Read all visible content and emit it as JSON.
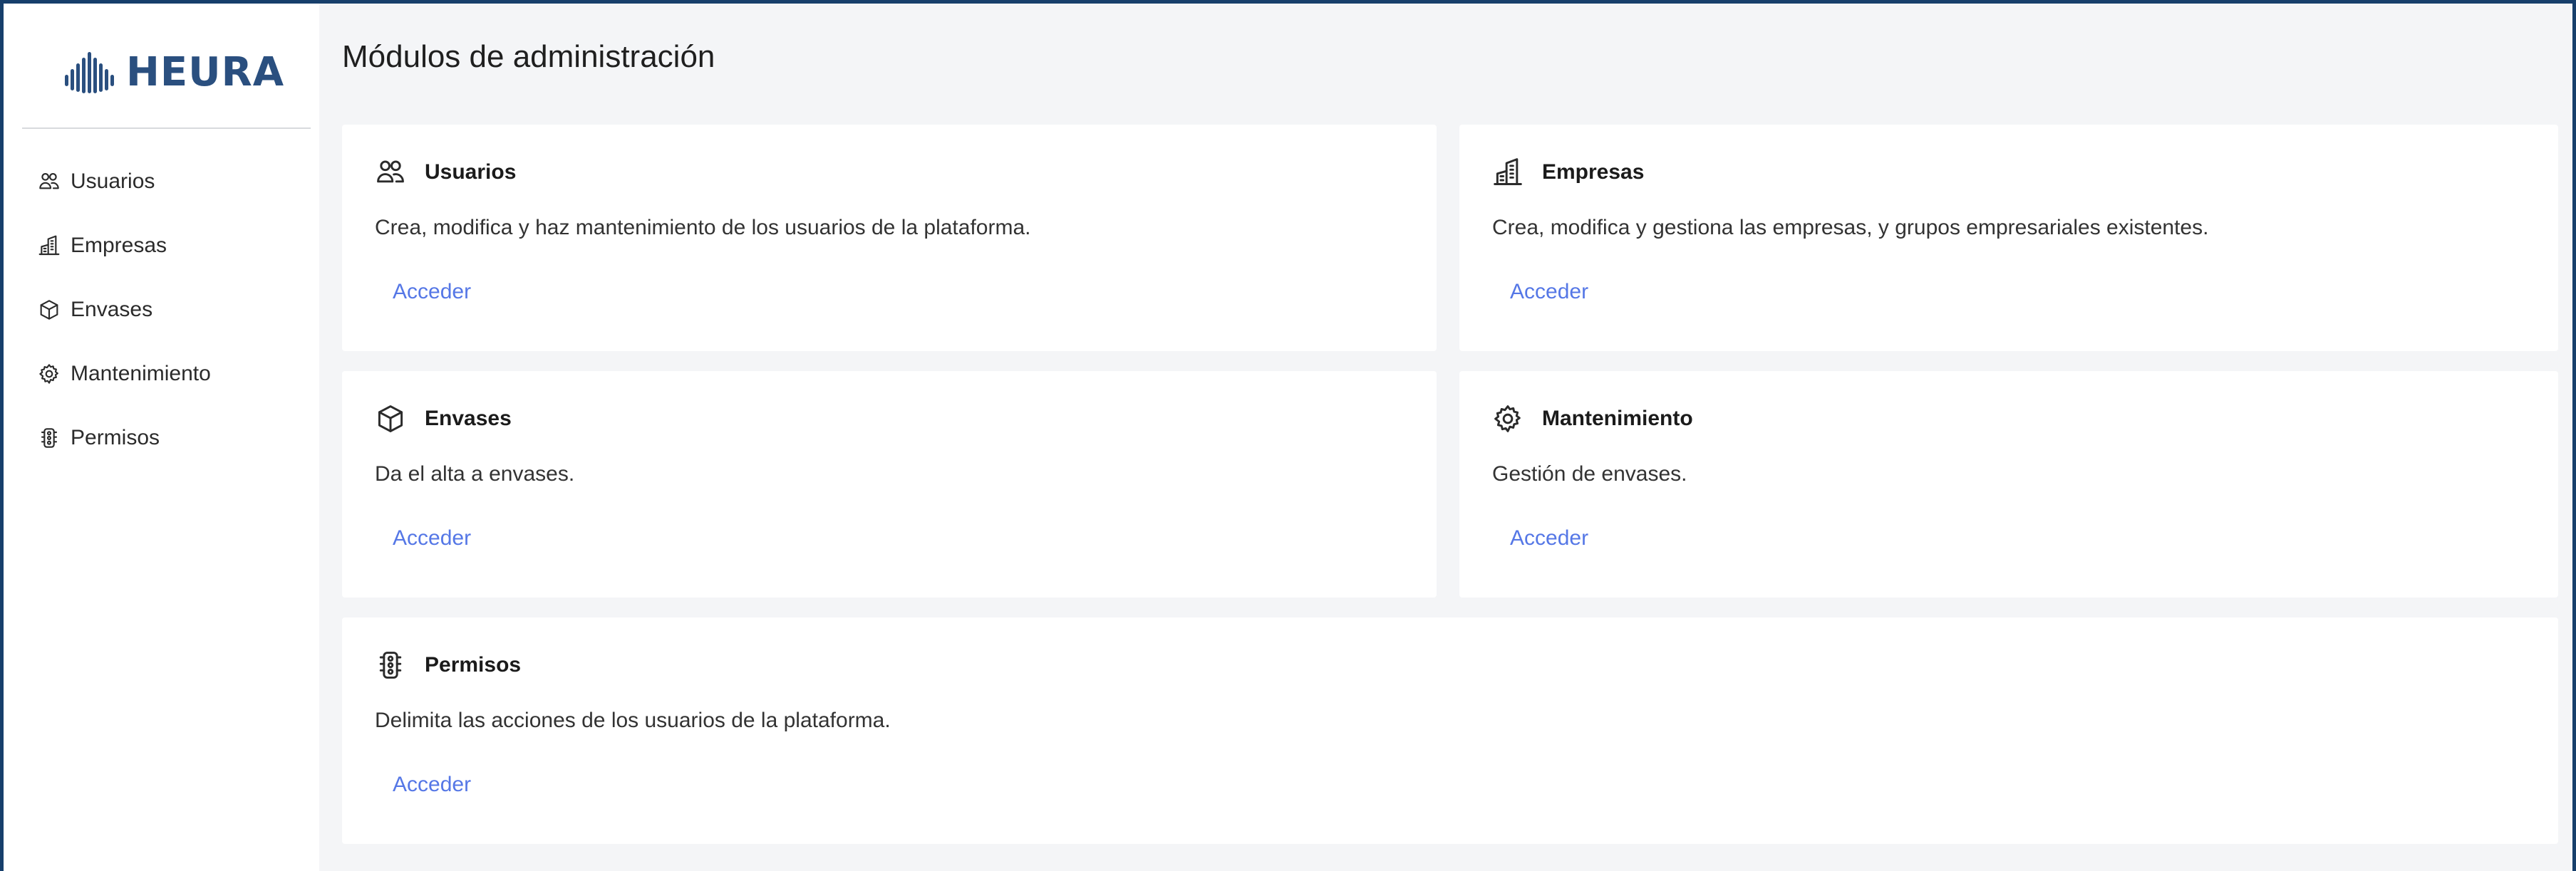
{
  "app": {
    "brand_name": "HEURA",
    "brand_color": "#2a4f7f",
    "accent_color": "#5577e6"
  },
  "sidebar": {
    "items": [
      {
        "label": "Usuarios",
        "icon": "users-icon"
      },
      {
        "label": "Empresas",
        "icon": "building-icon"
      },
      {
        "label": "Envases",
        "icon": "box-icon"
      },
      {
        "label": "Mantenimiento",
        "icon": "gear-icon"
      },
      {
        "label": "Permisos",
        "icon": "traffic-light-icon"
      }
    ]
  },
  "main": {
    "title": "Módulos de administración",
    "cards": [
      {
        "title": "Usuarios",
        "description": "Crea, modifica y haz mantenimiento de los usuarios de la plataforma.",
        "link": "Acceder",
        "icon": "users-icon"
      },
      {
        "title": "Empresas",
        "description": "Crea, modifica y gestiona las empresas, y grupos empresariales existentes.",
        "link": "Acceder",
        "icon": "building-icon"
      },
      {
        "title": "Envases",
        "description": "Da el alta a envases.",
        "link": "Acceder",
        "icon": "box-icon"
      },
      {
        "title": "Mantenimiento",
        "description": "Gestión de envases.",
        "link": "Acceder",
        "icon": "gear-icon"
      },
      {
        "title": "Permisos",
        "description": "Delimita las acciones de los usuarios de la plataforma.",
        "link": "Acceder",
        "icon": "traffic-light-icon"
      }
    ]
  }
}
